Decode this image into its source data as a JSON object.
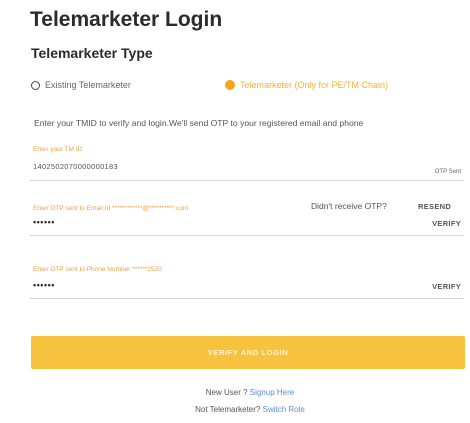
{
  "page": {
    "title": "Telemarketer Login",
    "type_heading": "Telemarketer Type"
  },
  "telemarketer_type": {
    "options": [
      {
        "label": "Existing Telemarketer",
        "selected": false
      },
      {
        "label": "Telemarketer (Only for PE/TM Chain)",
        "selected": true
      }
    ]
  },
  "instructions": "Enter your TMID to verify and login.We'll send OTP to your registered email and phone",
  "tmid_field": {
    "label": "Enter your TM ID",
    "value": "1402502070000000183",
    "status": "OTP Sent"
  },
  "email_otp_field": {
    "label": "Enter OTP sent to Email Id ************@**********.com",
    "value": "••••••",
    "resend_prompt": "Didn't receive OTP?",
    "resend_label": "RESEND",
    "verify_label": "VERIFY"
  },
  "phone_otp_field": {
    "label": "Enter OTP sent to Phone Number ******2520",
    "value": "••••••",
    "verify_label": "VERIFY"
  },
  "submit_label": "VERIFY AND LOGIN",
  "footer": {
    "new_user_text": "New User ?",
    "signup_link": "Signup Here",
    "not_tm_text": "Not Telemarketer?",
    "switch_link": "Switch Role"
  },
  "colors": {
    "accent": "#f5a41f",
    "button": "#f7c33f",
    "link": "#5a8fd8"
  }
}
